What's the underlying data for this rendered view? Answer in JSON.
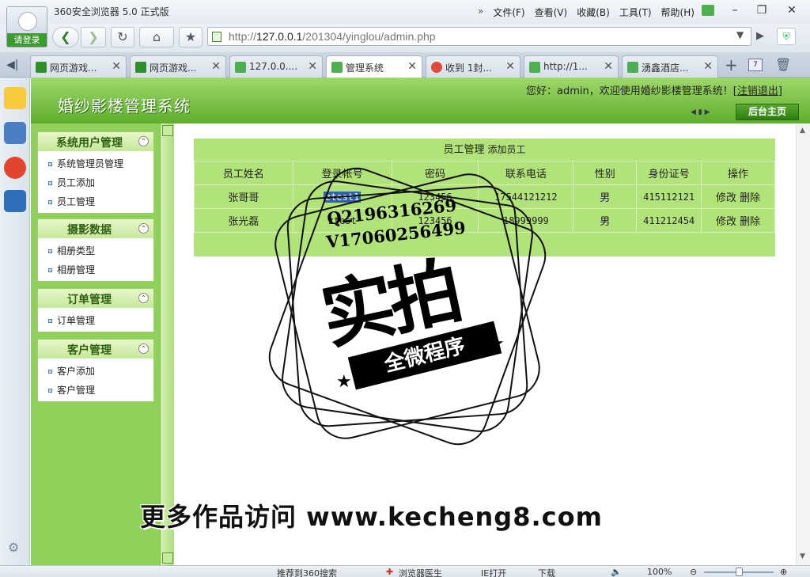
{
  "browser": {
    "title": "360安全浏览器 5.0 正式版",
    "login_label": "请登录",
    "menu": [
      "文件(F)",
      "查看(V)",
      "收藏(B)",
      "工具(T)",
      "帮助(H)"
    ],
    "menu_arrow": "»",
    "window_buttons": {
      "minimize": "–",
      "restore": "❐",
      "close": "✕"
    },
    "address": {
      "prefix": "http://",
      "host": "127.0.0.1",
      "path": "/201304/yinglou/admin.php"
    },
    "tabs": [
      {
        "label": "网页游戏...",
        "icon_color": "#2f8f2a",
        "icon_text": "361"
      },
      {
        "label": "网页游戏...",
        "icon_color": "#2f8f2a",
        "icon_text": "361"
      },
      {
        "label": "127.0.0....",
        "icon_color": "#4caf50",
        "icon_text": ""
      },
      {
        "label": "管理系统",
        "icon_color": "#4caf50",
        "icon_text": "",
        "active": true
      },
      {
        "label": "收到 1封...",
        "icon_color": "#e24a3b",
        "icon_text": ""
      },
      {
        "label": "http://1...",
        "icon_color": "#4caf50",
        "icon_text": ""
      },
      {
        "label": "湧鑫酒店...",
        "icon_color": "#4caf50",
        "icon_text": ""
      }
    ],
    "tab_count": "7",
    "status": {
      "recommend": "推荐到360搜索",
      "doctor": "浏览器医生",
      "ie_open": "IE打开",
      "download": "下载",
      "zoom": "100%"
    }
  },
  "site": {
    "title": "婚纱影楼管理系统",
    "welcome": "您好：admin，欢迎使用婚纱影楼管理系统！[",
    "logout": "注销退出",
    "welcome_end": "]",
    "home_button": "后台主页",
    "menus": [
      {
        "title": "系统用户管理",
        "items": [
          "系统管理员管理",
          "员工添加",
          "员工管理"
        ]
      },
      {
        "title": "摄影数据",
        "items": [
          "相册类型",
          "相册管理"
        ]
      },
      {
        "title": "订单管理",
        "items": [
          "订单管理"
        ]
      },
      {
        "title": "客户管理",
        "items": [
          "客户添加",
          "客户管理"
        ]
      }
    ],
    "staff": {
      "caption": "员工管理",
      "add_link": "添加员工",
      "columns": [
        "员工姓名",
        "登录帐号",
        "密码",
        "联系电话",
        "性别",
        "身份证号",
        "操作"
      ],
      "rows": [
        {
          "name": "张哥哥",
          "account": "ztest1",
          "password": "123456",
          "phone": "17544121212",
          "gender": "男",
          "id_no": "415112121"
        },
        {
          "name": "张光磊",
          "account": "ztest",
          "password": "123456",
          "phone": "18999999",
          "gender": "男",
          "id_no": "411212454"
        }
      ],
      "edit": "修改",
      "delete": "删除"
    }
  },
  "watermark": {
    "qq": "Q2196316269",
    "wechat": "V17060256499",
    "big": "实拍",
    "ribbon": "全微程序",
    "promo": "更多作品访问 www.kecheng8.com"
  }
}
